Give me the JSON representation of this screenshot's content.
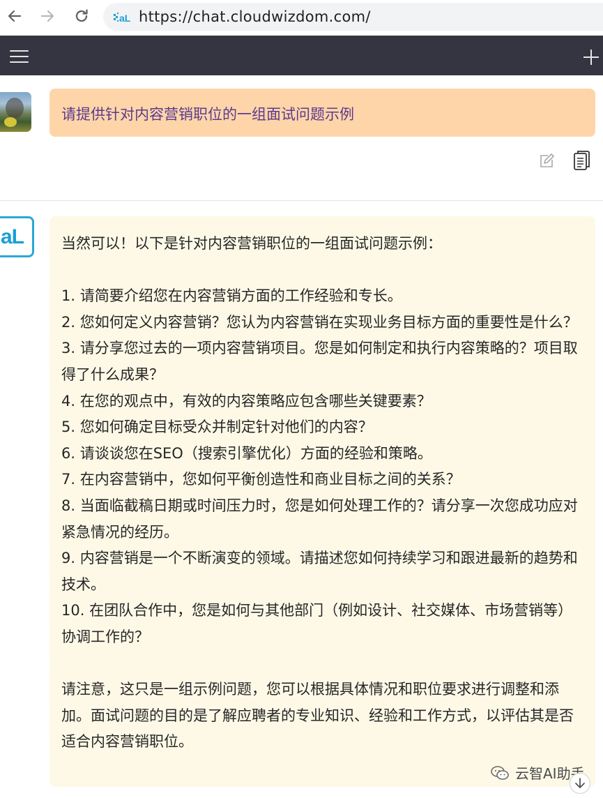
{
  "browser": {
    "url": "https://chat.cloudwizdom.com/"
  },
  "icons": {
    "back": "arrow-left-icon",
    "forward": "arrow-right-icon",
    "reload": "reload-icon",
    "menu": "hamburger-menu-icon",
    "new_chat": "plus-icon",
    "edit": "edit-icon",
    "copy": "copy-icon",
    "scroll_down": "arrow-down-icon"
  },
  "colors": {
    "header_bg": "#343541",
    "user_bubble_bg": "#fed5a9",
    "user_text": "#5b3a8c",
    "bot_bubble_bg": "#fef9e7",
    "brand_blue": "#1a9fd4"
  },
  "user_message": {
    "text": "请提供针对内容营销职位的一组面试问题示例"
  },
  "assistant": {
    "avatar_label": "aL",
    "intro": "当然可以！以下是针对内容营销职位的一组面试问题示例：",
    "questions": [
      "1. 请简要介绍您在内容营销方面的工作经验和专长。",
      "2. 您如何定义内容营销？您认为内容营销在实现业务目标方面的重要性是什么？",
      "3. 请分享您过去的一项内容营销项目。您是如何制定和执行内容策略的？项目取得了什么成果？",
      "4. 在您的观点中，有效的内容策略应包含哪些关键要素？",
      "5. 您如何确定目标受众并制定针对他们的内容？",
      "6. 请谈谈您在SEO（搜索引擎优化）方面的经验和策略。",
      "7. 在内容营销中，您如何平衡创造性和商业目标之间的关系？",
      "8. 当面临截稿日期或时间压力时，您是如何处理工作的？请分享一次您成功应对紧急情况的经历。",
      "9. 内容营销是一个不断演变的领域。请描述您如何持续学习和跟进最新的趋势和技术。",
      "10. 在团队合作中，您是如何与其他部门（例如设计、社交媒体、市场营销等）协调工作的？"
    ],
    "closing": "请注意，这只是一组示例问题，您可以根据具体情况和职位要求进行调整和添加。面试问题的目的是了解应聘者的专业知识、经验和工作方式，以评估其是否适合内容营销职位。"
  },
  "watermark": {
    "text": "云智AI助手"
  }
}
